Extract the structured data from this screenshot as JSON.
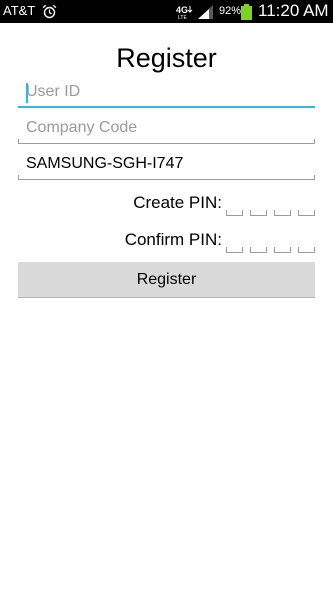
{
  "status_bar": {
    "carrier": "AT&T",
    "network_icon": "4g-lte-icon",
    "signal_icon": "signal-strength-icon",
    "alarm_icon": "alarm-clock-icon",
    "battery_percent": "92%",
    "battery_icon": "battery-icon",
    "battery_color": "#7ed321",
    "time": "11:20 AM"
  },
  "page": {
    "title": "Register"
  },
  "form": {
    "user_id": {
      "placeholder": "User ID",
      "value": ""
    },
    "company_code": {
      "placeholder": "Company Code",
      "value": ""
    },
    "device_name": {
      "value": "SAMSUNG-SGH-I747"
    },
    "create_pin_label": "Create PIN:",
    "confirm_pin_label": "Confirm PIN:",
    "pin_digits": 4,
    "register_button": "Register"
  },
  "colors": {
    "accent_focus": "#33b5e5",
    "button_bg": "#d9d9d9",
    "placeholder": "#9a9a9a"
  }
}
